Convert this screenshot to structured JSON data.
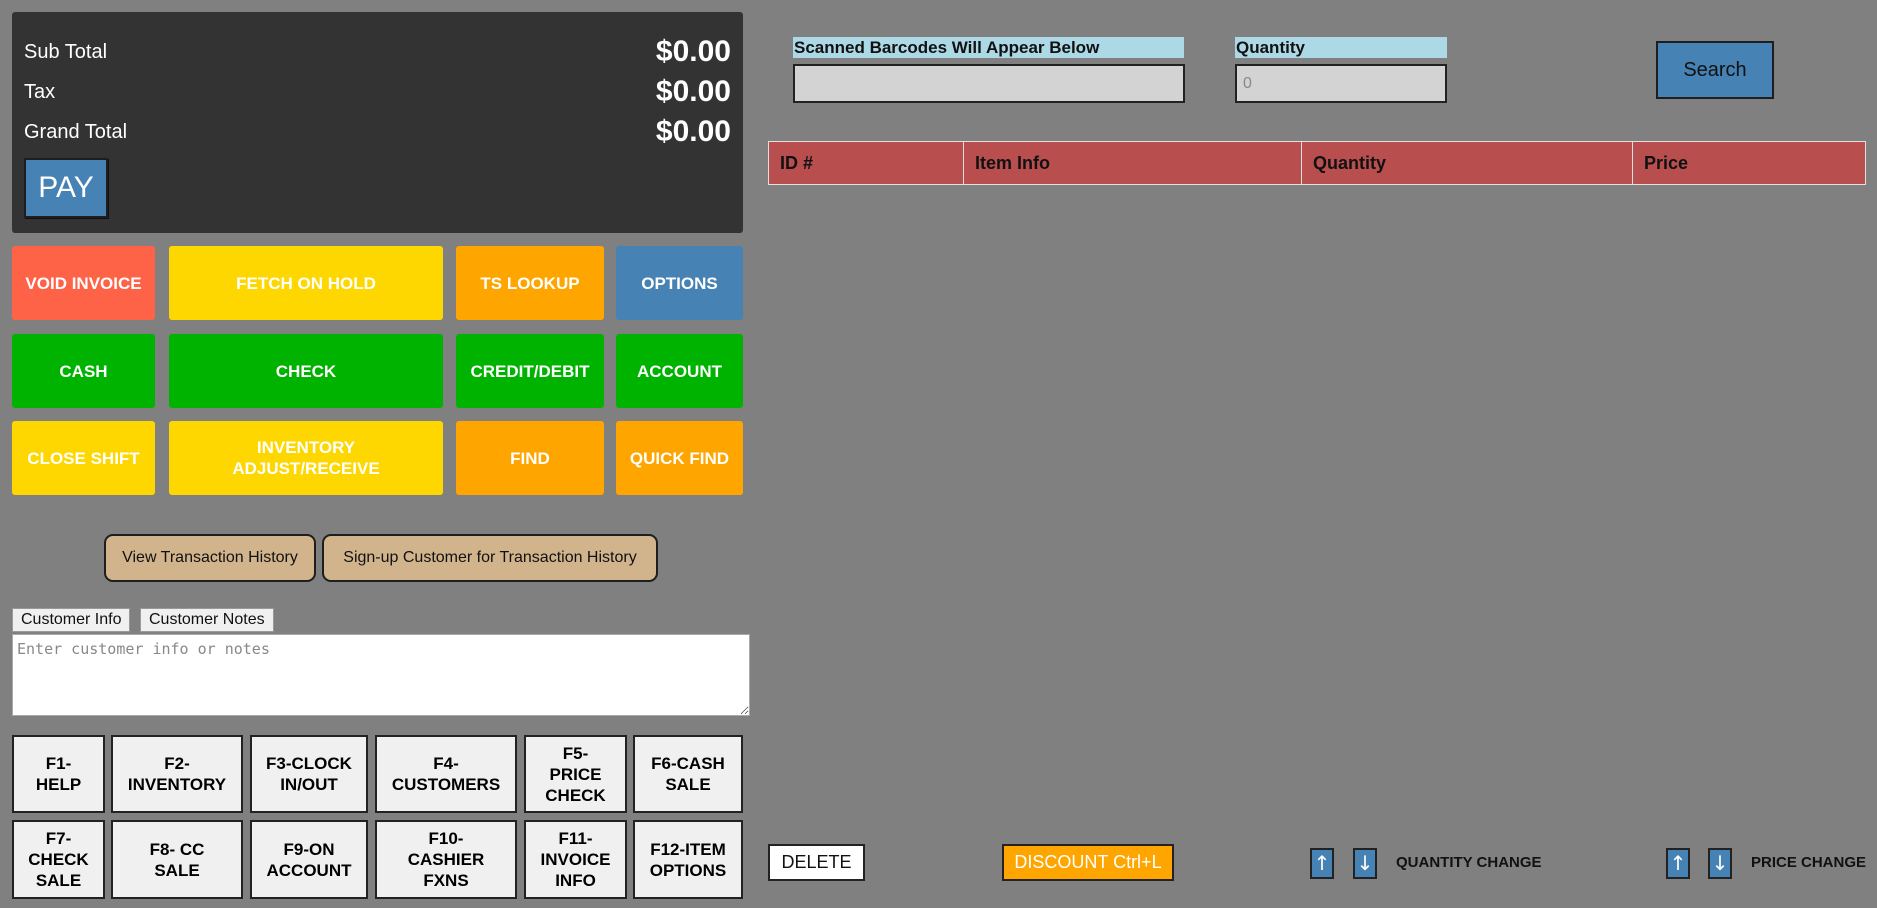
{
  "totals": {
    "subtotal_label": "Sub Total",
    "subtotal_value": "$0.00",
    "tax_label": "Tax",
    "tax_value": "$0.00",
    "grand_label": "Grand Total",
    "grand_value": "$0.00",
    "pay_label": "PAY"
  },
  "actions": {
    "void_invoice": "VOID INVOICE",
    "fetch_on_hold": "FETCH ON HOLD",
    "ts_lookup": "TS LOOKUP",
    "options": "OPTIONS",
    "cash": "CASH",
    "check": "CHECK",
    "credit_debit": "CREDIT/DEBIT",
    "account": "ACCOUNT",
    "close_shift": "CLOSE SHIFT",
    "inventory_line1": "INVENTORY",
    "inventory_line2": "ADJUST/RECEIVE",
    "find": "FIND",
    "quick_find": "QUICK FIND"
  },
  "history": {
    "view_label": "View Transaction History",
    "signup_label": "Sign-up Customer for Transaction History"
  },
  "customer": {
    "tab_info": "Customer Info",
    "tab_notes": "Customer Notes",
    "notes_placeholder": "Enter customer info or notes"
  },
  "fkeys": {
    "f1": [
      "F1-",
      "HELP"
    ],
    "f2": [
      "F2-",
      "INVENTORY"
    ],
    "f3": [
      "F3-CLOCK",
      "IN/OUT"
    ],
    "f4": [
      "F4-",
      "CUSTOMERS"
    ],
    "f5": [
      "F5-",
      "PRICE",
      "CHECK"
    ],
    "f6": [
      "F6-CASH",
      "SALE"
    ],
    "f7": [
      "F7-",
      "CHECK",
      "SALE"
    ],
    "f8": [
      "F8- CC",
      "SALE"
    ],
    "f9": [
      "F9-ON",
      "ACCOUNT"
    ],
    "f10": [
      "F10-",
      "CASHIER",
      "FXNS"
    ],
    "f11": [
      "F11-",
      "INVOICE",
      "INFO"
    ],
    "f12": [
      "F12-ITEM",
      "OPTIONS"
    ]
  },
  "scan": {
    "barcode_label": "Scanned Barcodes Will Appear Below",
    "barcode_value": "",
    "quantity_label": "Quantity",
    "quantity_placeholder": "0",
    "search_label": "Search"
  },
  "table": {
    "col_id": "ID #",
    "col_item": "Item Info",
    "col_qty": "Quantity",
    "col_price": "Price",
    "rows": []
  },
  "bottom": {
    "delete_label": "DELETE",
    "discount_label": "DISCOUNT Ctrl+L",
    "arrow_up": "↑",
    "arrow_down": "↓",
    "quantity_change": "QUANTITY CHANGE",
    "price_change": "PRICE CHANGE"
  },
  "colors": {
    "background": "#808080",
    "totals_panel": "#333333",
    "table_header": "#b94e4e",
    "blue": "#4682b4",
    "green": "#00b300",
    "yellow": "#ffd700",
    "orange": "#ffa500",
    "red": "#ff6347"
  }
}
